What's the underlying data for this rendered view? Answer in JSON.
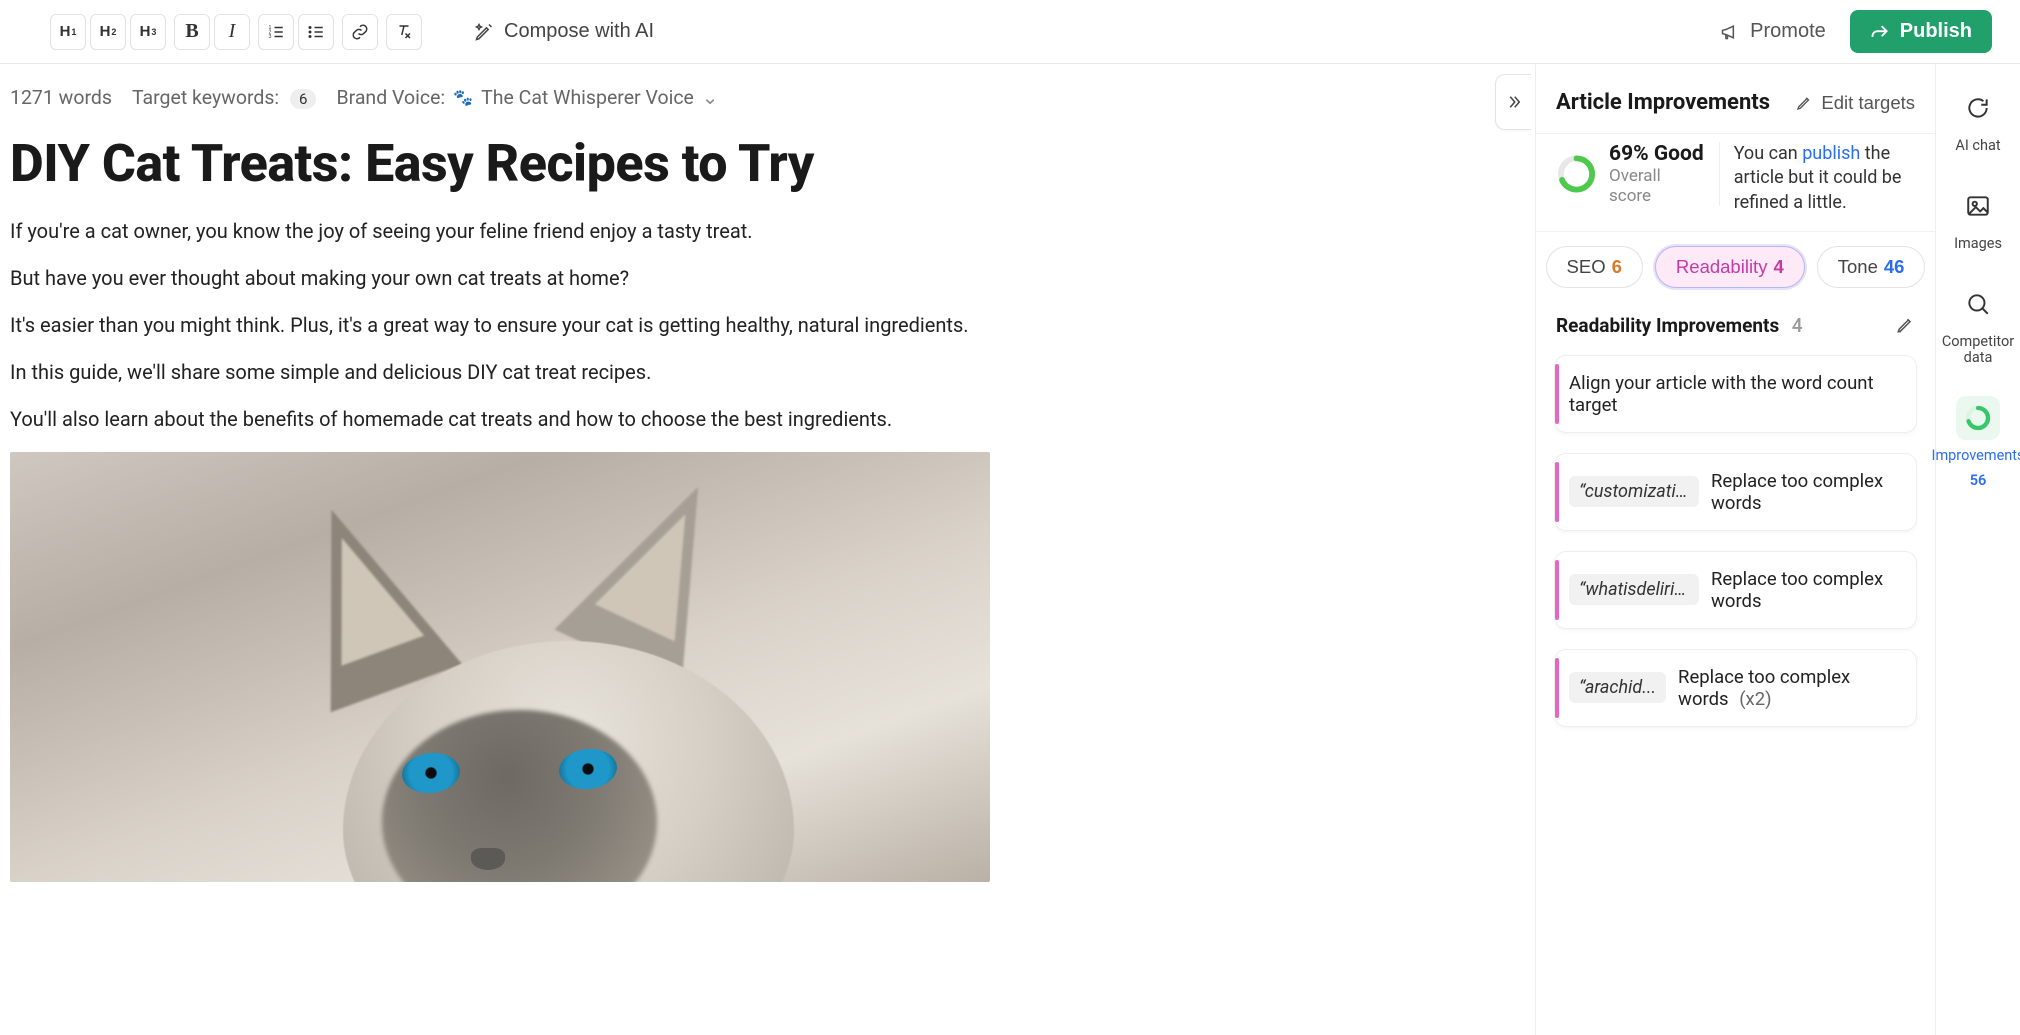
{
  "toolbar": {
    "h1": "H",
    "h2": "H",
    "h3": "H",
    "compose_label": "Compose with AI",
    "promote_label": "Promote",
    "publish_label": "Publish"
  },
  "meta": {
    "word_count": "1271 words",
    "target_keywords_label": "Target keywords:",
    "target_keywords_count": "6",
    "brand_voice_label": "Brand Voice:",
    "brand_voice_value": "The Cat Whisperer Voice"
  },
  "article": {
    "title": "DIY Cat Treats: Easy Recipes to Try",
    "paragraphs": [
      "If you're a cat owner, you know the joy of seeing your feline friend enjoy a tasty treat.",
      "But have you ever thought about making your own cat treats at home?",
      "It's easier than you might think. Plus, it's a great way to ensure your cat is getting healthy, natural ingredients.",
      "In this guide, we'll share some simple and delicious DIY cat treat recipes.",
      "You'll also learn about the benefits of homemade cat treats and how to choose the best ingredients."
    ]
  },
  "panel": {
    "title": "Article Improvements",
    "edit_targets": "Edit targets",
    "score_value": "69% Good",
    "score_label": "Overall score",
    "score_msg_pre": "You can ",
    "score_msg_link": "publish",
    "score_msg_post": " the article but it could be refined a little.",
    "tabs": {
      "seo_label": "SEO",
      "seo_count": "6",
      "read_label": "Readability",
      "read_count": "4",
      "tone_label": "Tone",
      "tone_count": "46"
    },
    "section_title": "Readability Improvements",
    "section_count": "4",
    "cards": [
      {
        "chip": "",
        "text": "Align your article with the word count target",
        "suffix": ""
      },
      {
        "chip": "“customization”",
        "text": "Replace too complex words",
        "suffix": ""
      },
      {
        "chip": "“whatisdeliriu...",
        "text": "Replace too complex words",
        "suffix": ""
      },
      {
        "chip": "“arachid...",
        "text": "Replace too complex words",
        "suffix": "(x2)"
      }
    ]
  },
  "rail": {
    "ai_chat": "AI chat",
    "images": "Images",
    "competitor": "Competitor data",
    "improvements_label": "Improvements",
    "improvements_count": "56"
  }
}
